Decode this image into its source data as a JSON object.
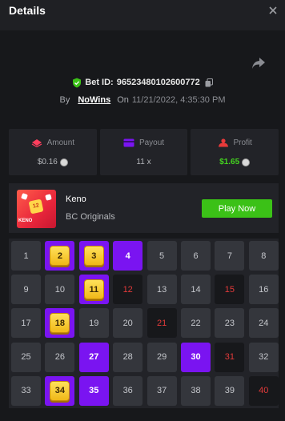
{
  "header": {
    "title": "Details"
  },
  "bet": {
    "id_label": "Bet ID:",
    "id": "96523480102600772"
  },
  "byline": {
    "by_label": "By",
    "username": "NoWins",
    "on_label": "On",
    "datetime": "11/21/2022, 4:35:30 PM"
  },
  "stats": {
    "amount": {
      "label": "Amount",
      "value": "$0.16"
    },
    "payout": {
      "label": "Payout",
      "value": "11 x"
    },
    "profit": {
      "label": "Profit",
      "value": "$1.65"
    }
  },
  "game": {
    "name": "Keno",
    "provider": "BC Originals",
    "play_label": "Play Now",
    "thumb_number": "12",
    "thumb_label": "KENO"
  },
  "colors": {
    "win_green": "#3bc117",
    "selected_purple": "#7a14f1",
    "drawn_red": "#e23a3a",
    "profit_green": "#44d31f"
  },
  "icons": {
    "shield": "shield-check-icon",
    "copy": "copy-icon",
    "share": "share-icon",
    "close": "close-icon",
    "amount": "amount-icon",
    "payout": "payout-icon",
    "profit": "profit-icon",
    "coin": "coin-icon"
  },
  "grid": {
    "columns": 8,
    "cells": [
      {
        "n": "1",
        "s": "normal"
      },
      {
        "n": "2",
        "s": "hit"
      },
      {
        "n": "3",
        "s": "hit"
      },
      {
        "n": "4",
        "s": "selected"
      },
      {
        "n": "5",
        "s": "normal"
      },
      {
        "n": "6",
        "s": "normal"
      },
      {
        "n": "7",
        "s": "normal"
      },
      {
        "n": "8",
        "s": "normal"
      },
      {
        "n": "9",
        "s": "normal"
      },
      {
        "n": "10",
        "s": "normal"
      },
      {
        "n": "11",
        "s": "hit"
      },
      {
        "n": "12",
        "s": "drawn"
      },
      {
        "n": "13",
        "s": "normal"
      },
      {
        "n": "14",
        "s": "normal"
      },
      {
        "n": "15",
        "s": "drawn"
      },
      {
        "n": "16",
        "s": "normal"
      },
      {
        "n": "17",
        "s": "normal"
      },
      {
        "n": "18",
        "s": "hit"
      },
      {
        "n": "19",
        "s": "normal"
      },
      {
        "n": "20",
        "s": "normal"
      },
      {
        "n": "21",
        "s": "drawn"
      },
      {
        "n": "22",
        "s": "normal"
      },
      {
        "n": "23",
        "s": "normal"
      },
      {
        "n": "24",
        "s": "normal"
      },
      {
        "n": "25",
        "s": "normal"
      },
      {
        "n": "26",
        "s": "normal"
      },
      {
        "n": "27",
        "s": "selected"
      },
      {
        "n": "28",
        "s": "normal"
      },
      {
        "n": "29",
        "s": "normal"
      },
      {
        "n": "30",
        "s": "selected"
      },
      {
        "n": "31",
        "s": "drawn"
      },
      {
        "n": "32",
        "s": "normal"
      },
      {
        "n": "33",
        "s": "normal"
      },
      {
        "n": "34",
        "s": "hit"
      },
      {
        "n": "35",
        "s": "selected"
      },
      {
        "n": "36",
        "s": "normal"
      },
      {
        "n": "37",
        "s": "normal"
      },
      {
        "n": "38",
        "s": "normal"
      },
      {
        "n": "39",
        "s": "normal"
      },
      {
        "n": "40",
        "s": "drawn"
      }
    ]
  }
}
